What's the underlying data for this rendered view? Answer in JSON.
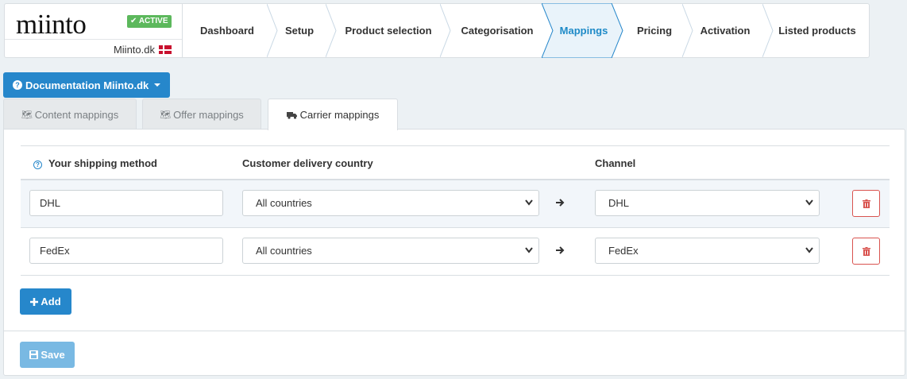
{
  "brand": {
    "logo": "miinto",
    "status": "ACTIVE",
    "site": "Miinto.dk"
  },
  "steps": [
    {
      "label": "Dashboard"
    },
    {
      "label": "Setup"
    },
    {
      "label": "Product selection"
    },
    {
      "label": "Categorisation"
    },
    {
      "label": "Mappings",
      "active": true
    },
    {
      "label": "Pricing"
    },
    {
      "label": "Activation"
    },
    {
      "label": "Listed products"
    }
  ],
  "doc_button": {
    "label": "Documentation Miinto.dk"
  },
  "tabs": [
    {
      "label": "Content mappings"
    },
    {
      "label": "Offer mappings"
    },
    {
      "label": "Carrier mappings",
      "active": true
    }
  ],
  "table": {
    "headers": {
      "method": "Your shipping method",
      "country": "Customer delivery country",
      "channel": "Channel"
    },
    "rows": [
      {
        "method": "DHL",
        "country": "All countries",
        "channel": "DHL"
      },
      {
        "method": "FedEx",
        "country": "All countries",
        "channel": "FedEx"
      }
    ]
  },
  "buttons": {
    "add": "Add",
    "save": "Save"
  },
  "colors": {
    "primary": "#2687cb",
    "success": "#5cb85c",
    "danger": "#d9534f",
    "save_disabled": "#79b9e3"
  }
}
